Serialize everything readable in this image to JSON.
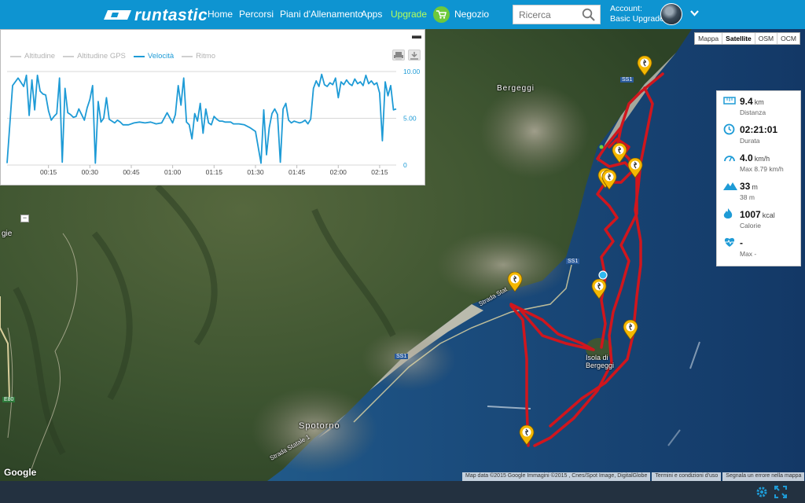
{
  "brand": {
    "name": "runtastic"
  },
  "nav": {
    "home": "Home",
    "routes": "Percorsi",
    "plans": "Piani d'Allenamento",
    "apps": "Apps",
    "upgrade": "Upgrade",
    "shop": "Negozio"
  },
  "search": {
    "placeholder": "Ricerca"
  },
  "account": {
    "label": "Account:",
    "plan": "Basic Upgrade"
  },
  "chart_panel": {
    "legend": [
      "Altitudine",
      "Altitudine GPS",
      "Velocità",
      "Ritmo"
    ],
    "active_series": "Velocità",
    "print_icon": "print-icon",
    "download_icon": "download-icon"
  },
  "chart_data": {
    "type": "line",
    "series": [
      {
        "name": "Velocità",
        "x_minutes": [
          0,
          2,
          4,
          6,
          7,
          8,
          9,
          10,
          11,
          12,
          13,
          14,
          15,
          16,
          17,
          18,
          19,
          20,
          21,
          22,
          23,
          24,
          25,
          26,
          27,
          28,
          29,
          30,
          31,
          32,
          33,
          34,
          35,
          36,
          37,
          38,
          39,
          40,
          41,
          42,
          44,
          46,
          48,
          50,
          52,
          54,
          56,
          58,
          60,
          61,
          62,
          63,
          64,
          65,
          66,
          67,
          68,
          69,
          70,
          71,
          72,
          73,
          74,
          75,
          76,
          77,
          78,
          79,
          80,
          81,
          82,
          84,
          86,
          88,
          90,
          92,
          93,
          94,
          95,
          96,
          97,
          98,
          99,
          100,
          101,
          102,
          103,
          104,
          105,
          106,
          107,
          108,
          109,
          110,
          111,
          112,
          113,
          114,
          115,
          116,
          117,
          118,
          119,
          120,
          121,
          122,
          123,
          124,
          125,
          126,
          127,
          128,
          129,
          130,
          131,
          132,
          133,
          134,
          135,
          136,
          137,
          138,
          139,
          140,
          141
        ],
        "values": [
          0.2,
          8.5,
          9.3,
          8.4,
          9.6,
          5.3,
          9.1,
          5.9,
          9.6,
          7.9,
          7.6,
          7.5,
          5.8,
          4.8,
          5.2,
          5.5,
          9.3,
          0.3,
          8.2,
          5.6,
          5.4,
          5.1,
          5.2,
          6.0,
          5.4,
          4.8,
          6.1,
          7.0,
          8.5,
          0.2,
          6.8,
          4.6,
          5.0,
          7.2,
          4.9,
          4.7,
          4.5,
          4.8,
          4.6,
          4.3,
          4.3,
          4.5,
          4.6,
          4.5,
          4.6,
          4.4,
          4.5,
          5.6,
          4.5,
          5.4,
          8.5,
          6.4,
          9.3,
          4.6,
          4.3,
          2.8,
          5.5,
          4.7,
          6.6,
          3.4,
          6.0,
          4.5,
          4.3,
          5.2,
          4.9,
          4.7,
          4.7,
          4.6,
          4.6,
          4.6,
          4.4,
          4.4,
          4.3,
          4.0,
          3.6,
          0.2,
          5.9,
          1.1,
          4.0,
          5.5,
          6.0,
          5.4,
          0.3,
          6.0,
          6.6,
          4.8,
          4.5,
          4.7,
          4.6,
          4.5,
          4.6,
          4.8,
          4.4,
          4.9,
          8.2,
          9.0,
          8.4,
          9.7,
          8.6,
          8.4,
          8.8,
          8.6,
          9.3,
          7.2,
          8.9,
          8.6,
          9.1,
          8.7,
          8.5,
          9.2,
          8.7,
          8.9,
          8.5,
          9.6,
          8.7,
          9.0,
          8.6,
          8.8,
          7.7,
          2.6,
          8.9,
          7.4,
          8.5,
          5.9,
          6.0
        ]
      }
    ],
    "xlabel": "",
    "ylabel": "",
    "x_range_minutes": [
      0,
      141
    ],
    "ylim": [
      0,
      10
    ],
    "x_tick_labels": [
      "00:15",
      "00:30",
      "00:45",
      "01:00",
      "01:15",
      "01:30",
      "01:45",
      "02:00",
      "02:15"
    ],
    "x_tick_minutes": [
      15,
      30,
      45,
      60,
      75,
      90,
      105,
      120,
      135
    ],
    "y_tick_labels": [
      "10.00",
      "5.00",
      "0"
    ],
    "y_tick_values": [
      10,
      5,
      0
    ],
    "grid": true,
    "line_color": "#1e9bd6"
  },
  "map": {
    "types": [
      "Mappa",
      "Satellite",
      "OSM",
      "OCM"
    ],
    "selected_type": "Satellite",
    "labels": {
      "bergeggi": "Bergeggi",
      "isola_line1": "Isola di",
      "isola_line2": "Bergeggi",
      "spotorno": "Spotorno",
      "strada1": "Strada Stat",
      "strada2": "Strada Statale 1",
      "ss1_a": "SS1",
      "ss1_b": "SS1",
      "ss1_c": "SS1",
      "e80": "E80",
      "gie": "gie"
    },
    "route_color": "#d0161d",
    "marker_color": "#f5b800"
  },
  "stats": {
    "distance": {
      "value": "9.4",
      "unit": "km",
      "label": "Distanza"
    },
    "duration": {
      "value": "02:21:01",
      "label": "Durata"
    },
    "speed": {
      "value": "4.0",
      "unit": "km/h",
      "sub": "Max 8.79 km/h"
    },
    "elevation": {
      "value": "33",
      "unit": "m",
      "sub": "38 m"
    },
    "calories": {
      "value": "1007",
      "unit": "kcal",
      "label": "Calorie"
    },
    "heart": {
      "value": "-",
      "sub": "Max -"
    }
  },
  "attribution": {
    "google": "Google",
    "data": "Map data ©2015 Google Immagini ©2015 , Cnes/Spot Image, DigitalGlobe",
    "terms": "Termini e condizioni d'uso",
    "report": "Segnala un errore nella mappa"
  },
  "footer": {
    "settings_icon": "gear-icon",
    "fullscreen_icon": "fullscreen-icon"
  }
}
